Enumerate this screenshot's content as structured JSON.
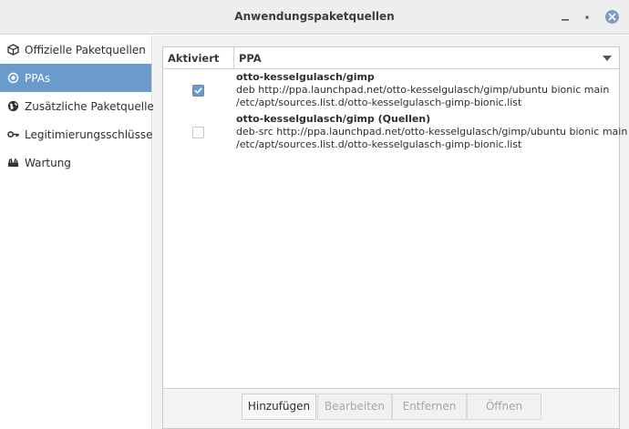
{
  "window": {
    "title": "Anwendungspaketquellen"
  },
  "sidebar": {
    "items": [
      {
        "label": "Offizielle Paketquellen",
        "icon": "package-icon",
        "active": false
      },
      {
        "label": "PPAs",
        "icon": "target-icon",
        "active": true
      },
      {
        "label": "Zusätzliche Paketquellen",
        "icon": "globe-icon",
        "active": false
      },
      {
        "label": "Legitimierungsschlüssel",
        "icon": "key-icon",
        "active": false
      },
      {
        "label": "Wartung",
        "icon": "tools-icon",
        "active": false
      }
    ]
  },
  "table": {
    "columns": [
      "Aktiviert",
      "PPA"
    ],
    "rows": [
      {
        "enabled": true,
        "name": "otto-kesselgulasch/gimp",
        "line": "deb http://ppa.launchpad.net/otto-kesselgulasch/gimp/ubuntu bionic main",
        "file": "/etc/apt/sources.list.d/otto-kesselgulasch-gimp-bionic.list"
      },
      {
        "enabled": false,
        "name": "otto-kesselgulasch/gimp (Quellen)",
        "line": "deb-src http://ppa.launchpad.net/otto-kesselgulasch/gimp/ubuntu bionic main",
        "file": "/etc/apt/sources.list.d/otto-kesselgulasch-gimp-bionic.list"
      }
    ]
  },
  "buttons": {
    "add": "Hinzufügen",
    "edit": "Bearbeiten",
    "remove": "Entfernen",
    "open": "Öffnen"
  },
  "colors": {
    "accent": "#6b9bcb",
    "close_button": "#7d9cc4"
  }
}
